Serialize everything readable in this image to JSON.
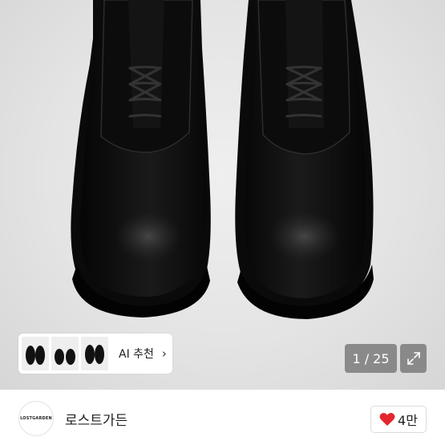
{
  "product_image": {
    "alt_subject": "black leather derby shoes"
  },
  "ai_recommend": {
    "label": "AI 추천",
    "chevron": "chevron-right-icon"
  },
  "gallery": {
    "counter": "1 / 25",
    "expand_icon": "expand-icon"
  },
  "shop": {
    "logo_text": "LOSTGARDEN",
    "name": "로스트가든"
  },
  "like": {
    "icon": "heart-icon",
    "count": "4만",
    "heart_color": "#e3262f"
  }
}
